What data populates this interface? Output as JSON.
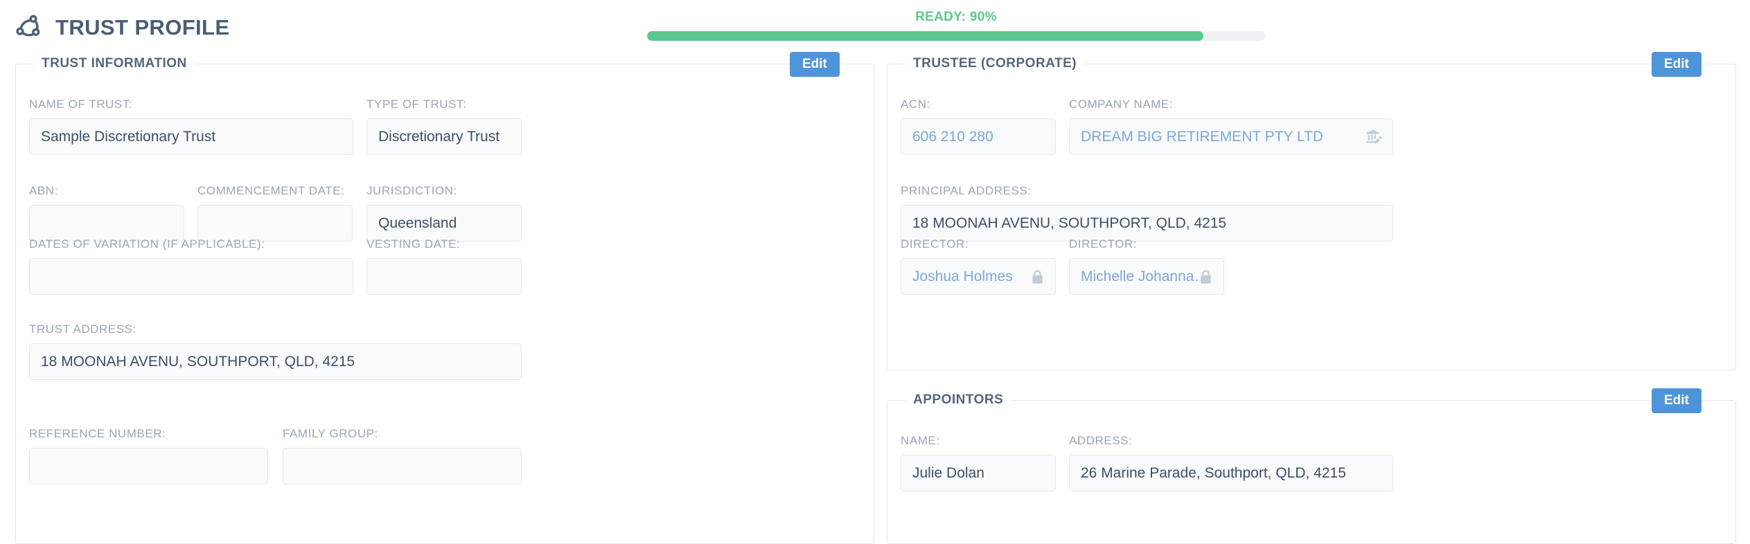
{
  "header": {
    "logo_icon": "share-network-icon",
    "title": "TRUST PROFILE",
    "progress": {
      "label": "READY: 90%",
      "percent": 90,
      "fill_color": "#5bc98d",
      "track_color": "#eef0f3"
    }
  },
  "edit_label": "Edit",
  "accent_color": "#4e94d9",
  "panels": {
    "trust_information": {
      "legend": "TRUST INFORMATION",
      "edit_label": "Edit",
      "fields": [
        {
          "label": "NAME OF TRUST:",
          "value": "Sample Discretionary Trust"
        },
        {
          "label": "TYPE OF TRUST:",
          "value": "Discretionary Trust"
        },
        {
          "label": "ABN:",
          "value": ""
        },
        {
          "label": "COMMENCEMENT DATE:",
          "value": ""
        },
        {
          "label": "JURISDICTION:",
          "value": "Queensland"
        },
        {
          "label": "DATES OF VARIATION (IF APPLICABLE):",
          "value": ""
        },
        {
          "label": "VESTING DATE:",
          "value": ""
        },
        {
          "label": "TRUST ADDRESS:",
          "value": "18 MOONAH AVENU, SOUTHPORT, QLD, 4215"
        },
        {
          "label": "REFERENCE NUMBER:",
          "value": ""
        },
        {
          "label": "FAMILY GROUP:",
          "value": ""
        }
      ]
    },
    "trustee_corporate": {
      "legend": "TRUSTEE (CORPORATE)",
      "edit_label": "Edit",
      "fields": [
        {
          "label": "ACN:",
          "value": "606 210 280",
          "style": "link"
        },
        {
          "label": "COMPANY NAME:",
          "value": "DREAM BIG RETIREMENT PTY LTD",
          "style": "link",
          "icon": "company-edit-icon"
        },
        {
          "label": "PRINCIPAL ADDRESS:",
          "value": "18 MOONAH AVENU, SOUTHPORT, QLD, 4215"
        },
        {
          "label": "DIRECTOR:",
          "value": "Joshua Holmes",
          "style": "link",
          "icon": "lock-icon"
        },
        {
          "label": "DIRECTOR:",
          "value": "Michelle Johanna Holmes",
          "style": "link",
          "icon": "lock-icon"
        }
      ]
    },
    "appointors": {
      "legend": "APPOINTORS",
      "edit_label": "Edit",
      "fields": [
        {
          "label": "NAME:",
          "value": "Julie Dolan"
        },
        {
          "label": "ADDRESS:",
          "value": "26 Marine Parade, Southport, QLD, 4215"
        }
      ]
    }
  }
}
